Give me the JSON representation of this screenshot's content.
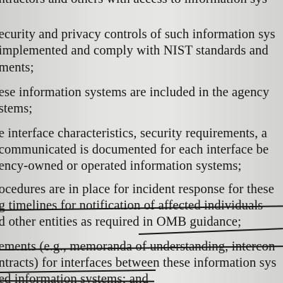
{
  "document": {
    "lines": [
      "ntractors and others with access to information sys",
      "ecurity and privacy controls of such information sys",
      "implemented and comply with NIST standards and",
      "ments;",
      "ese information systems are included in the agency",
      "stems;",
      "e interface characteristics, security requirements, a",
      "communicated is documented for each interface be",
      "ency-owned or operated information systems;",
      "ocedures are in place for incident response for these",
      "g timelines for notification of affected individuals",
      "d other entities as required in OMB guidance;",
      "ements (e.g., memoranda of understanding, intercon",
      "ntracts) for interfaces between these information sys",
      "ed information systems; and"
    ]
  }
}
